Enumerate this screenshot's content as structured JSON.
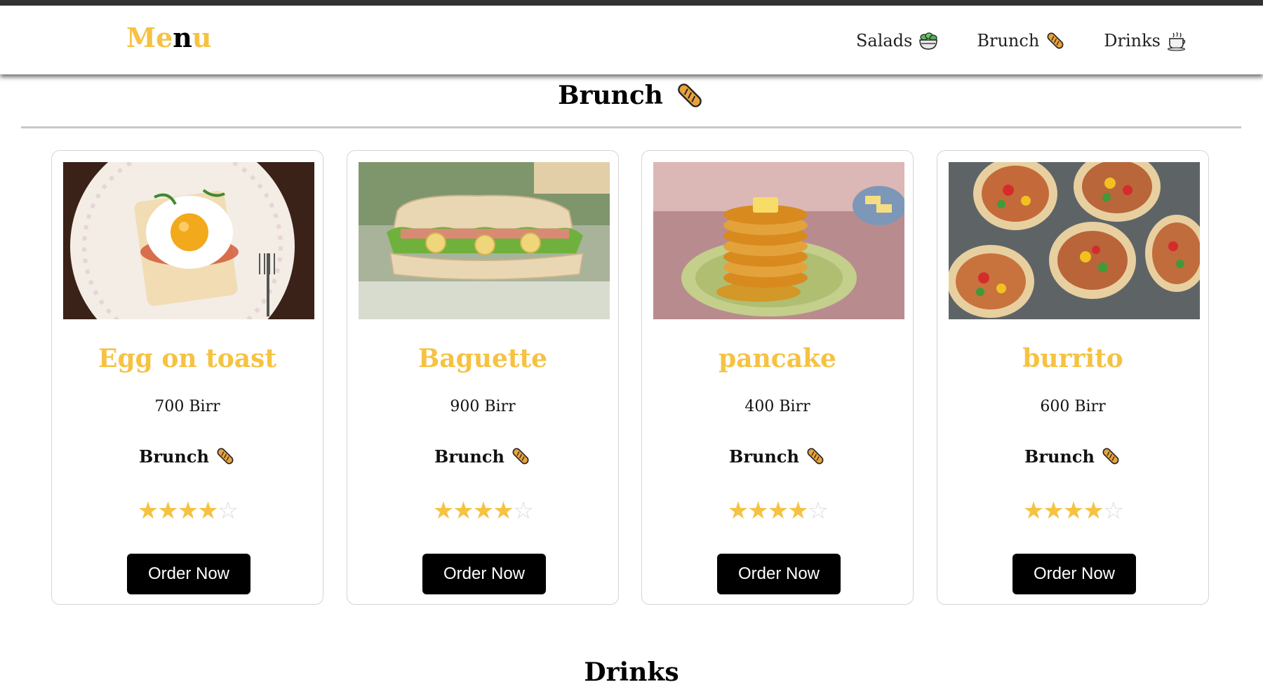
{
  "nav": {
    "logo_part1": "Me",
    "logo_part2": "n",
    "logo_part3": "u",
    "links": [
      {
        "label": "Salads",
        "icon": "salad-bowl-icon"
      },
      {
        "label": "Brunch",
        "icon": "baguette-icon"
      },
      {
        "label": "Drinks",
        "icon": "coffee-cup-icon"
      }
    ]
  },
  "section": {
    "title": "Brunch",
    "icon": "baguette-icon"
  },
  "cards": [
    {
      "title": "Egg on toast",
      "price": "700 Birr",
      "category": "Brunch",
      "rating": 4,
      "max_rating": 5,
      "button": "Order Now",
      "image": "egg-on-toast-photo"
    },
    {
      "title": "Baguette",
      "price": "900 Birr",
      "category": "Brunch",
      "rating": 4,
      "max_rating": 5,
      "button": "Order Now",
      "image": "baguette-sandwich-photo"
    },
    {
      "title": "pancake",
      "price": "400 Birr",
      "category": "Brunch",
      "rating": 4,
      "max_rating": 5,
      "button": "Order Now",
      "image": "pancake-stack-photo"
    },
    {
      "title": "burrito",
      "price": "600 Birr",
      "category": "Brunch",
      "rating": 4,
      "max_rating": 5,
      "button": "Order Now",
      "image": "burrito-wraps-photo"
    }
  ],
  "next_section": {
    "title": "Drinks"
  },
  "colors": {
    "accent": "#f5c242",
    "button": "#000000",
    "border": "#d4d4d4"
  }
}
